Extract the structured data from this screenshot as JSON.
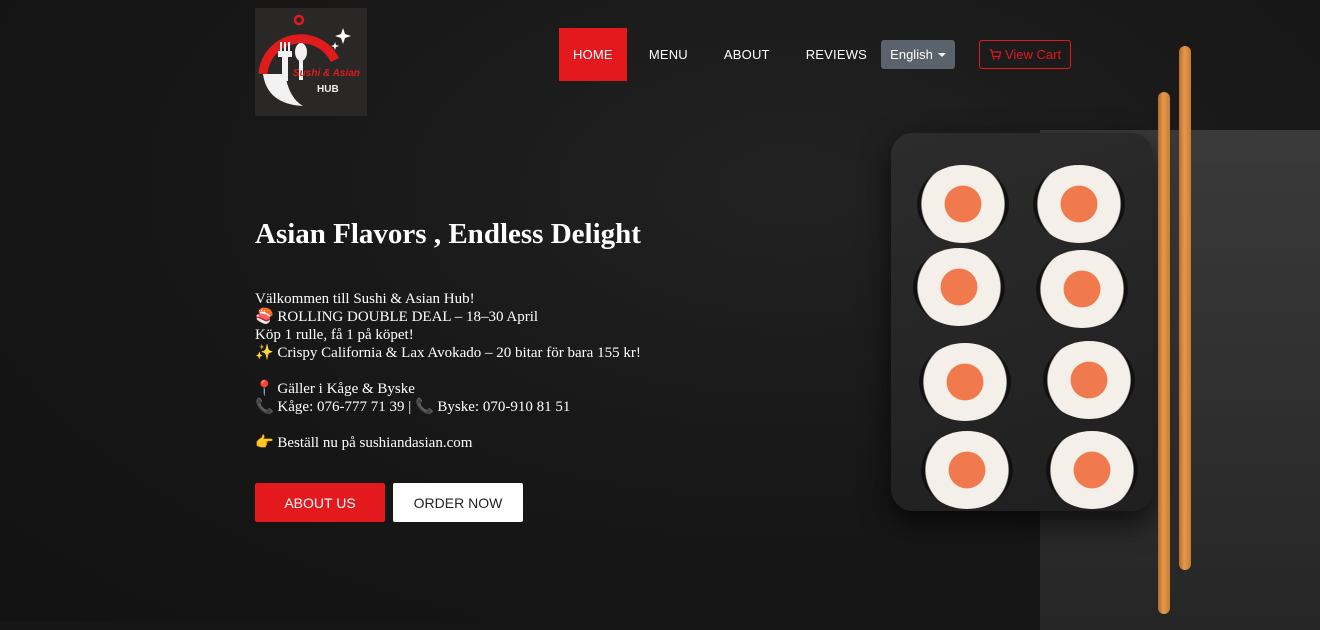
{
  "logo": {
    "line1": "Sushi & Asian",
    "line2": "HUB",
    "icon": "cloche-fork-spoon-logo"
  },
  "nav": {
    "items": [
      {
        "label": "HOME",
        "active": true
      },
      {
        "label": "MENU",
        "active": false
      },
      {
        "label": "ABOUT",
        "active": false
      },
      {
        "label": "REVIEWS",
        "active": false
      }
    ]
  },
  "header": {
    "language_label": "English",
    "cart_label": "View Cart",
    "cart_icon": "cart-icon"
  },
  "hero": {
    "title": "Asian Flavors , Endless Delight",
    "lines": [
      "Välkommen till Sushi & Asian Hub!",
      "🍣 ROLLING DOUBLE DEAL – 18–30 April",
      "Köp 1 rulle, få 1 på köpet!",
      "✨ Crispy California & Lax Avokado – 20 bitar för bara 155 kr!",
      "📍 Gäller i Kåge & Byske",
      "📞 Kåge: 076-777 71 39 | 📞 Byske: 070-910 81 51",
      "👉 Beställ nu på sushiandasian.com"
    ],
    "about_button": "ABOUT US",
    "order_button": "ORDER NOW"
  },
  "colors": {
    "accent": "#e3191d",
    "background": "#151515",
    "language_button": "#5a636b"
  }
}
